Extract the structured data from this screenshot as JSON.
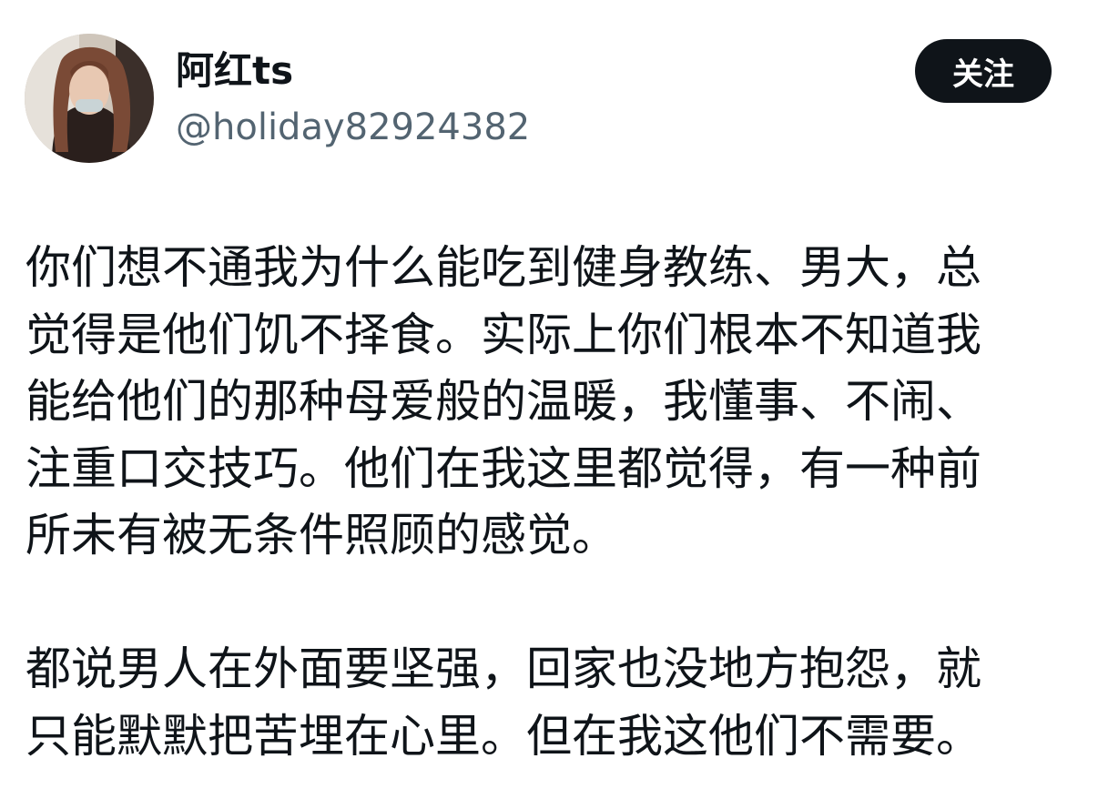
{
  "post": {
    "author": {
      "display_name": "阿红ts",
      "handle": "@holiday82924382",
      "avatar_icon": "user-avatar"
    },
    "follow_label": "关注",
    "paragraphs": [
      [
        "你们想不通我为什么能吃到健身教练、男大，总",
        "觉得是他们饥不择食。实际上你们根本不知道我",
        "能给他们的那种母爱般的温暖，我懂事、不闹、",
        "注重口交技巧。他们在我这里都觉得，有一种前",
        "所未有被无条件照顾的感觉。"
      ],
      [
        "都说男人在外面要坚强，回家也没地方抱怨，就",
        "只能默默把苦埋在心里。但在我这他们不需要。"
      ]
    ]
  },
  "colors": {
    "text": "#0f1419",
    "secondary_text": "#536471",
    "button_bg": "#0f1419",
    "button_text": "#ffffff",
    "background": "#ffffff"
  }
}
